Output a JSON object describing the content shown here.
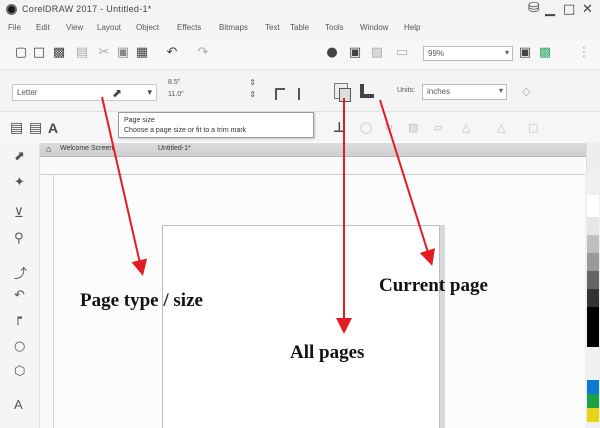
{
  "window": {
    "title": "CorelDRAW 2017 - Untitled-1*",
    "controls": {
      "minimize": "▁",
      "maximize": "□",
      "close": "✕"
    },
    "app_icon": "coreldraw-logo-icon"
  },
  "menubar": [
    "File",
    "Edit",
    "View",
    "Layout",
    "Object",
    "Effects",
    "Bitmaps",
    "Text",
    "Table",
    "Tools",
    "Window",
    "Help"
  ],
  "toolbar": {
    "zoom": "99%",
    "icons": [
      "new-icon",
      "open-icon",
      "save-icon",
      "print-icon",
      "cut-icon",
      "copy-icon",
      "paste-icon",
      "undo-icon",
      "redo-icon",
      "search-icon",
      "import-icon",
      "export-icon",
      "full-screen-icon",
      "snap-icon",
      "options-icon"
    ]
  },
  "property_bar": {
    "page_size": "Letter",
    "width": "8.5\"",
    "height": "11.0\"",
    "units_label": "Units:",
    "units": "inches"
  },
  "tooltip": {
    "title": "Page size",
    "body": "Choose a page size or fit to a trim mark"
  },
  "doc_tabs": {
    "welcome": "Welcome Screen",
    "document": "Untitled-1*"
  },
  "annotations": {
    "page_type": "Page type / size",
    "current_page": "Current page",
    "all_pages": "All pages",
    "arrow_color": "#e31b23"
  },
  "palette": [
    "#ffffff",
    "#e6e6e6",
    "#bfbfbf",
    "#999999",
    "#666666",
    "#333333",
    "#000000",
    "#0a7bd3",
    "#19a14a",
    "#e8d317"
  ]
}
